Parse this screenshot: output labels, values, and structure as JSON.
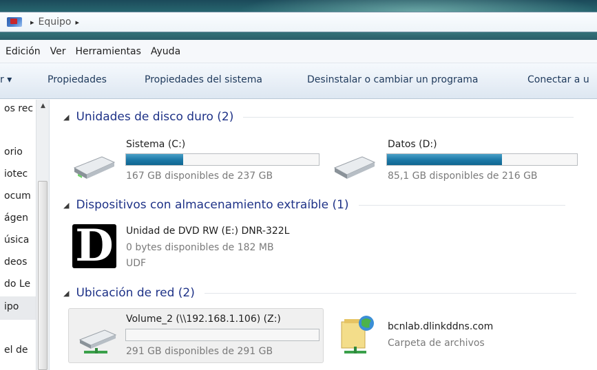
{
  "address": {
    "path_label": "Equipo",
    "chevron": "▸",
    "icon": "network-flag-icon"
  },
  "menu": {
    "items": [
      "Edición",
      "Ver",
      "Herramientas",
      "Ayuda"
    ]
  },
  "commands": {
    "first_partial": "r ▾",
    "items": [
      "Propiedades",
      "Propiedades del sistema",
      "Desinstalar o cambiar un programa",
      "Conectar a u"
    ]
  },
  "nav": {
    "items": [
      "os rec",
      "orio",
      "iotec",
      "ocum",
      "ágen",
      "úsica",
      "deos",
      "do Le",
      "ipo",
      "el de"
    ],
    "selected_index": 8,
    "scroll_up": "▲"
  },
  "groups": {
    "hdd": {
      "title": "Unidades de disco duro (2)",
      "expander": "◢"
    },
    "removable": {
      "title": "Dispositivos con almacenamiento extraíble (1)",
      "expander": "◢"
    },
    "network": {
      "title": "Ubicación de red (2)",
      "expander": "◢"
    }
  },
  "drives": {
    "c": {
      "name": "Sistema (C:)",
      "free": "167 GB disponibles de 237 GB",
      "used_fraction": 0.295
    },
    "d": {
      "name": "Datos (D:)",
      "free": "85,1 GB disponibles de 216 GB",
      "used_fraction": 0.606
    },
    "e": {
      "name": "Unidad de DVD RW (E:) DNR-322L",
      "free": "0 bytes disponibles de 182 MB",
      "fs": "UDF",
      "logo_letter": "D"
    },
    "z": {
      "name": "Volume_2 (\\\\192.168.1.106) (Z:)",
      "free": "291 GB disponibles de 291 GB",
      "used_fraction": 0.0
    },
    "web": {
      "name": "bcnlab.dlinkddns.com",
      "type": "Carpeta de archivos"
    }
  },
  "colors": {
    "accent": "#1e3287",
    "bar_fill": "#1e7aa8"
  }
}
